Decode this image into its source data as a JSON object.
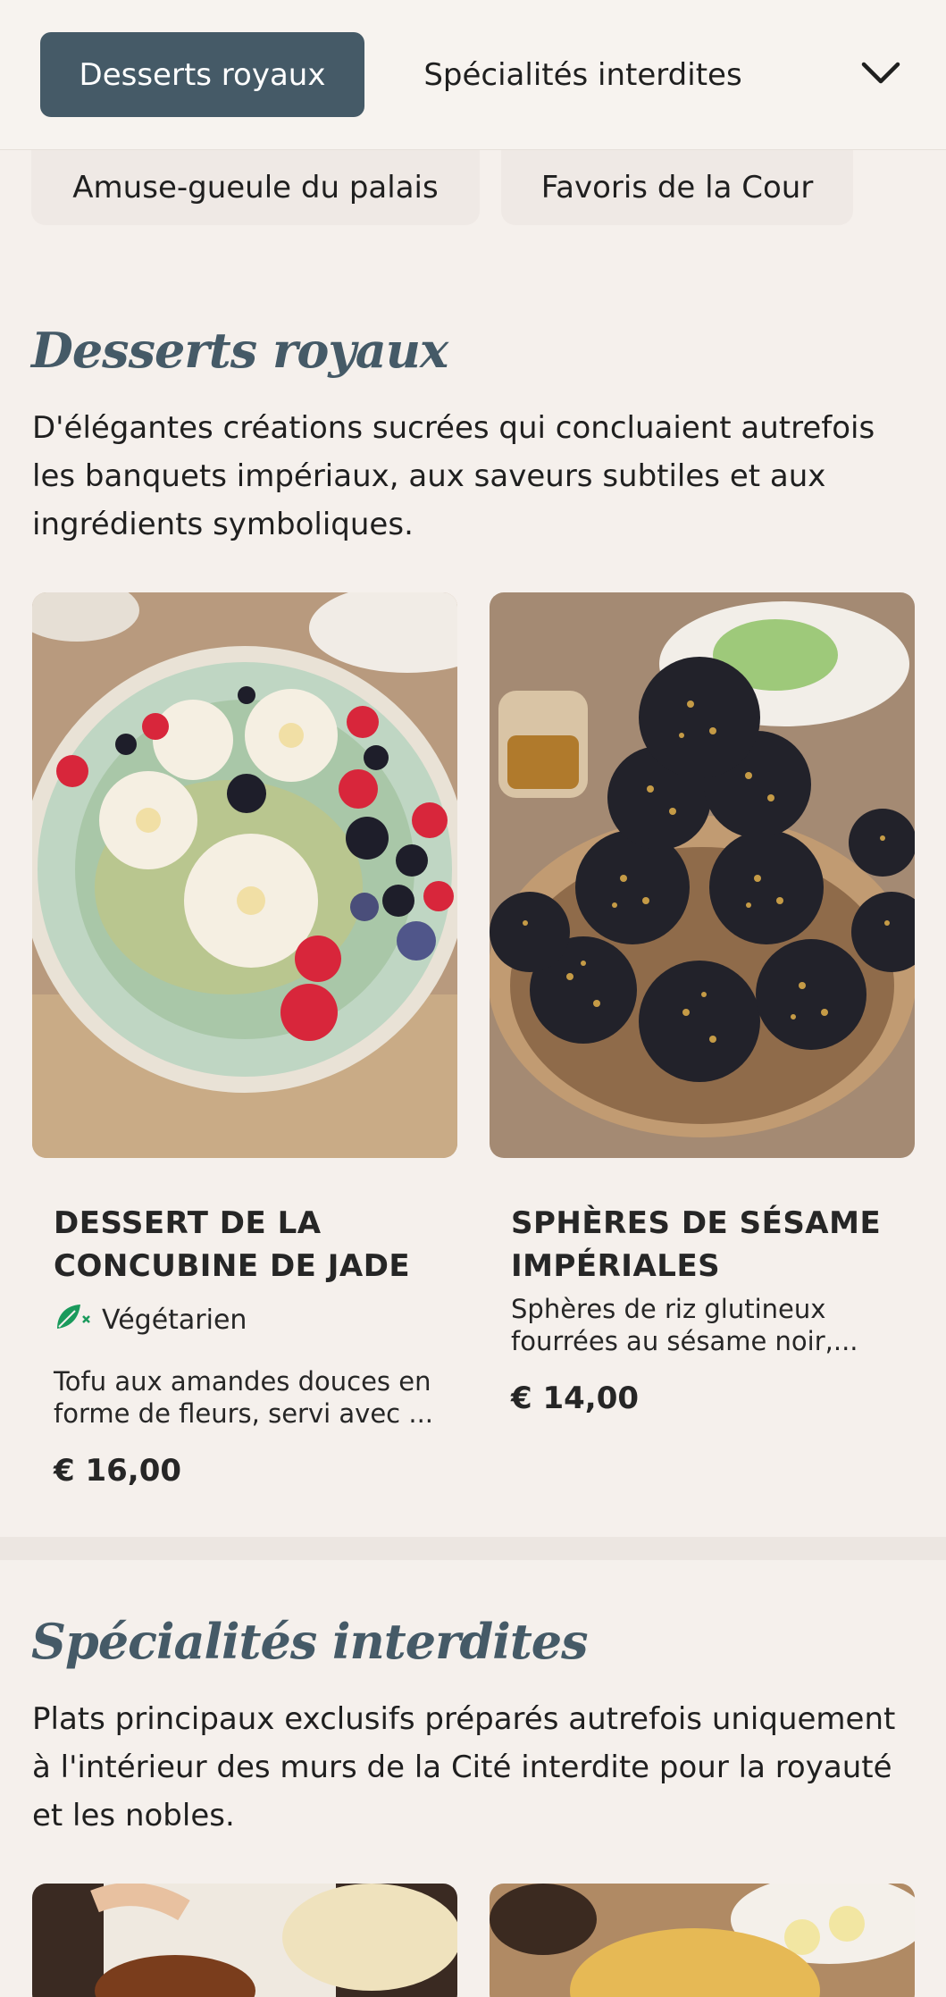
{
  "nav": {
    "active_tab": "Desserts royaux",
    "tab_2": "Spécialités interdites",
    "tab_3": "Amuse-gueule du palais",
    "tab_4": "Favoris de la Cour",
    "expand_icon": "chevron-down-icon"
  },
  "sections": [
    {
      "title": "Desserts royaux",
      "description": "D'élégantes créations sucrées qui concluaient autrefois les banquets impériaux, aux saveurs subtiles et aux ingrédients symboliques.",
      "items": [
        {
          "name": "Dessert de la concubine de Jade",
          "badge": "Végétarien",
          "badge_icon": "vegetarian-leaf-icon",
          "description": "Tofu aux amandes douces en forme de fleurs, servi avec ...",
          "price": "€ 16,00"
        },
        {
          "name": "Sphères de sésame impériales",
          "description": "Sphères de riz glutineux fourrées au sésame noir,...",
          "price": "€ 14,00"
        }
      ]
    },
    {
      "title": "Spécialités interdites",
      "description": "Plats principaux exclusifs préparés autrefois uniquement à l'intérieur des murs de la Cité interdite pour la royauté et les nobles."
    }
  ],
  "colors": {
    "accent": "#455a67",
    "background": "#f5f0ec",
    "veg_green": "#1a9a5c"
  }
}
